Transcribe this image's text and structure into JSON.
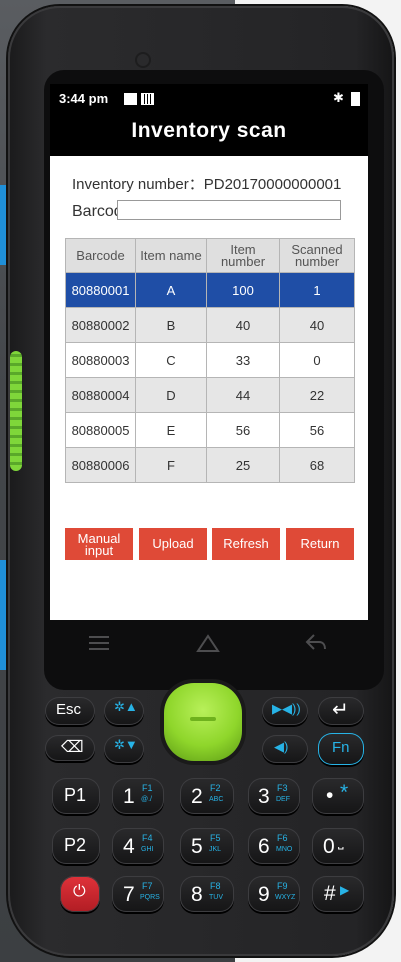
{
  "status_bar": {
    "time": "3:44 pm",
    "bluetooth_icon": "bluetooth-icon",
    "battery_icon": "battery-icon"
  },
  "app": {
    "title": "Inventory scan"
  },
  "form": {
    "inventory_label": "Inventory number：PD20170000000001",
    "barcode_label": "Barcode",
    "barcode_value": ""
  },
  "table": {
    "headers": [
      "Barcode",
      "Item name",
      "Item number",
      "Scanned number"
    ],
    "rows": [
      {
        "barcode": "80880001",
        "name": "A",
        "item_number": "100",
        "scanned": "1"
      },
      {
        "barcode": "80880002",
        "name": "B",
        "item_number": "40",
        "scanned": "40"
      },
      {
        "barcode": "80880003",
        "name": "C",
        "item_number": "33",
        "scanned": "0"
      },
      {
        "barcode": "80880004",
        "name": "D",
        "item_number": "44",
        "scanned": "22"
      },
      {
        "barcode": "80880005",
        "name": "E",
        "item_number": "56",
        "scanned": "56"
      },
      {
        "barcode": "80880006",
        "name": "F",
        "item_number": "25",
        "scanned": "68"
      }
    ],
    "selected_row": 0
  },
  "actions": {
    "manual": "Manual input",
    "upload": "Upload",
    "refresh": "Refresh",
    "return": "Return"
  },
  "colors": {
    "accent_red": "#df4a37",
    "selected_blue": "#1f4ea6",
    "scan_green": "#8fd62b",
    "key_blue": "#27b3e6"
  },
  "keypad": {
    "esc": "Esc",
    "fn": "Fn",
    "p1": "P1",
    "p2": "P2",
    "k1": "1",
    "k1_f": "F1",
    "k1_sub": "@./",
    "k2": "2",
    "k2_f": "F2",
    "k2_sub": "ABC",
    "k3": "3",
    "k3_f": "F3",
    "k3_sub": "DEF",
    "k4": "4",
    "k4_f": "F4",
    "k4_sub": "GHI",
    "k5": "5",
    "k5_f": "F5",
    "k5_sub": "JKL",
    "k6": "6",
    "k6_f": "F6",
    "k6_sub": "MNO",
    "k7": "7",
    "k7_f": "F7",
    "k7_sub": "PQRS",
    "k8": "8",
    "k8_f": "F8",
    "k8_sub": "TUV",
    "k9": "9",
    "k9_f": "F9",
    "k9_sub": "WXYZ",
    "k0": "0",
    "star": "•",
    "star_sub": "*",
    "hash": "#"
  }
}
